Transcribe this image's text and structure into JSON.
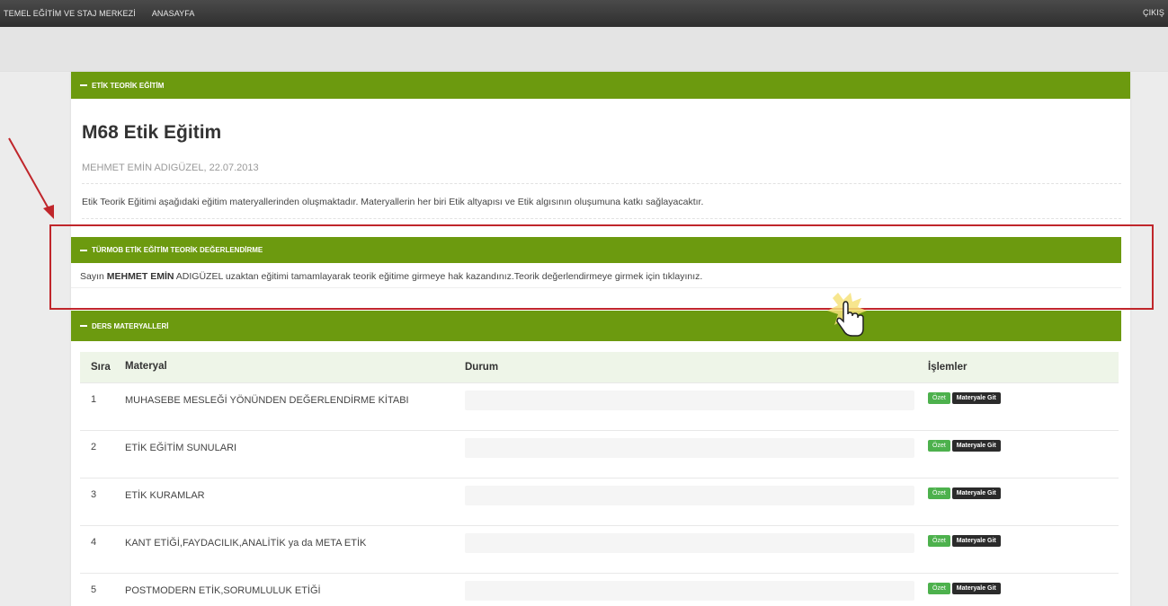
{
  "topbar": {
    "brand": "TEMEL EĞİTİM VE STAJ MERKEZİ",
    "home": "ANASAYFA",
    "logout": "ÇIKIŞ"
  },
  "theory_section": {
    "header": "ETİK TEORİK EĞİTİM",
    "title": "M68 Etik Eğitim",
    "author_line": "MEHMET EMİN ADIGÜZEL, 22.07.2013",
    "intro": "Etik Teorik Eğitimi aşağıdaki eğitim materyallerinden oluşmaktadır. Materyallerin her biri Etik altyapısı ve Etik algısının oluşumuna katkı sağlayacaktır."
  },
  "evaluation_section": {
    "header": "TÜRMOB ETİK EĞİTİM TEORİK DEĞERLENDİRME",
    "text_prefix": "Sayın ",
    "name_bold": "MEHMET EMİN",
    "text_middle": " ADIGÜZEL uzaktan eğitimi tamamlayarak teorik eğitime girmeye hak kazandınız.Teorik değerlendirmeye girmek için ",
    "link_text": "tıklayınız."
  },
  "materials_section": {
    "header": "DERS MATERYALLERİ",
    "columns": {
      "sira": "Sıra",
      "materyal": "Materyal",
      "durum": "Durum",
      "islemler": "İşlemler"
    },
    "rows": [
      {
        "sira": "1",
        "materyal": "MUHASEBE MESLEĞİ YÖNÜNDEN DEĞERLENDİRME KİTABI"
      },
      {
        "sira": "2",
        "materyal": "ETİK EĞİTİM SUNULARI"
      },
      {
        "sira": "3",
        "materyal": "ETİK KURAMLAR"
      },
      {
        "sira": "4",
        "materyal": "KANT ETİĞİ,FAYDACILIK,ANALİTİK ya da META ETİK"
      },
      {
        "sira": "5",
        "materyal": "POSTMODERN ETİK,SORUMLULUK ETİĞİ"
      }
    ],
    "summary_button": "Özet",
    "goto_button": "Materyale Git"
  },
  "colors": {
    "header_green": "#6c9a0f",
    "summary_green": "#4db14d",
    "annotation_red": "#c0262b"
  }
}
